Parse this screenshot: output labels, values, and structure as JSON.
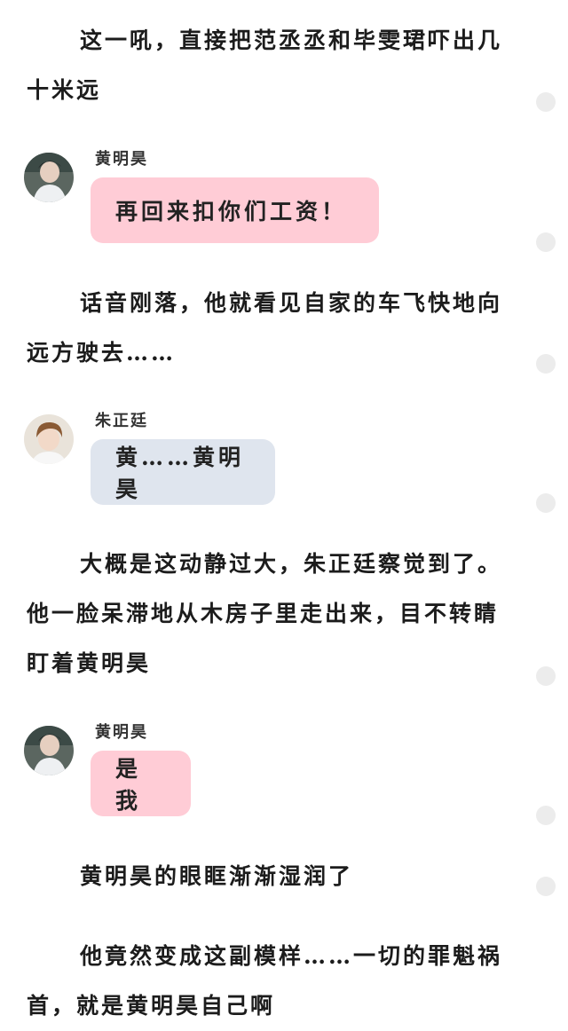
{
  "paragraphs": [
    "这一吼，直接把范丞丞和毕雯珺吓出几十米远",
    "话音刚落，他就看见自家的车飞快地向远方驶去……",
    "大概是这动静过大，朱正廷察觉到了。他一脸呆滞地从木房子里走出来，目不转睛盯着黄明昊",
    "黄明昊的眼眶渐渐湿润了",
    "他竟然变成这副模样……一切的罪魁祸首，就是黄明昊自己啊"
  ],
  "messages": [
    {
      "speaker": "黄明昊",
      "text": "再回来扣你们工资！",
      "avatar_icon": "avatar-huang-icon",
      "bubble_color": "#ffccd6"
    },
    {
      "speaker": "朱正廷",
      "text": "黄……黄明昊",
      "avatar_icon": "avatar-zhu-icon",
      "bubble_color": "#dfe5ee"
    },
    {
      "speaker": "黄明昊",
      "text": "是我",
      "avatar_icon": "avatar-huang-icon",
      "bubble_color": "#ffccd6"
    }
  ],
  "colors": {
    "pink_bubble": "#ffccd6",
    "blue_bubble": "#dfe5ee",
    "dot": "#ececec"
  }
}
